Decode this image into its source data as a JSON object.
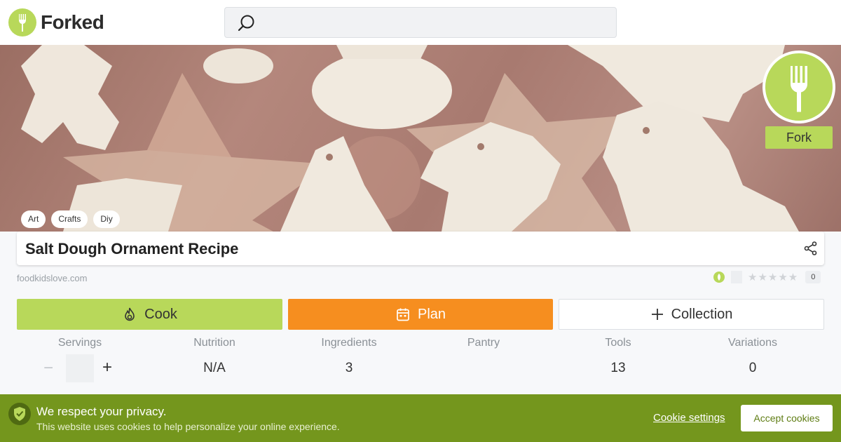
{
  "brand": {
    "name": "Forked",
    "color": "#b8d85a"
  },
  "search": {
    "icon": "search-icon",
    "value": ""
  },
  "hero": {
    "fork_label": "Fork",
    "tags": [
      "Art",
      "Crafts",
      "Diy"
    ]
  },
  "recipe": {
    "title": "Salt Dough Ornament Recipe",
    "source": "foodkidslove.com",
    "rating_count": "0",
    "stars": "★★★★★"
  },
  "actions": {
    "cook_label": "Cook",
    "plan_label": "Plan",
    "collection_label": "Collection",
    "cook_color": "#b8d85a",
    "plan_color": "#f68e1f"
  },
  "stats": {
    "servings": {
      "label": "Servings",
      "value": ""
    },
    "nutrition": {
      "label": "Nutrition",
      "value": "N/A"
    },
    "ingredients": {
      "label": "Ingredients",
      "value": "3"
    },
    "pantry": {
      "label": "Pantry",
      "value": ""
    },
    "tools": {
      "label": "Tools",
      "value": "13"
    },
    "variations": {
      "label": "Variations",
      "value": "0"
    },
    "minus": "−",
    "plus": "+"
  },
  "cookie": {
    "title": "We respect your privacy.",
    "text": "This website uses cookies to help personalize your online experience.",
    "settings_label": "Cookie settings",
    "accept_label": "Accept cookies",
    "banner_color": "#74961d"
  }
}
